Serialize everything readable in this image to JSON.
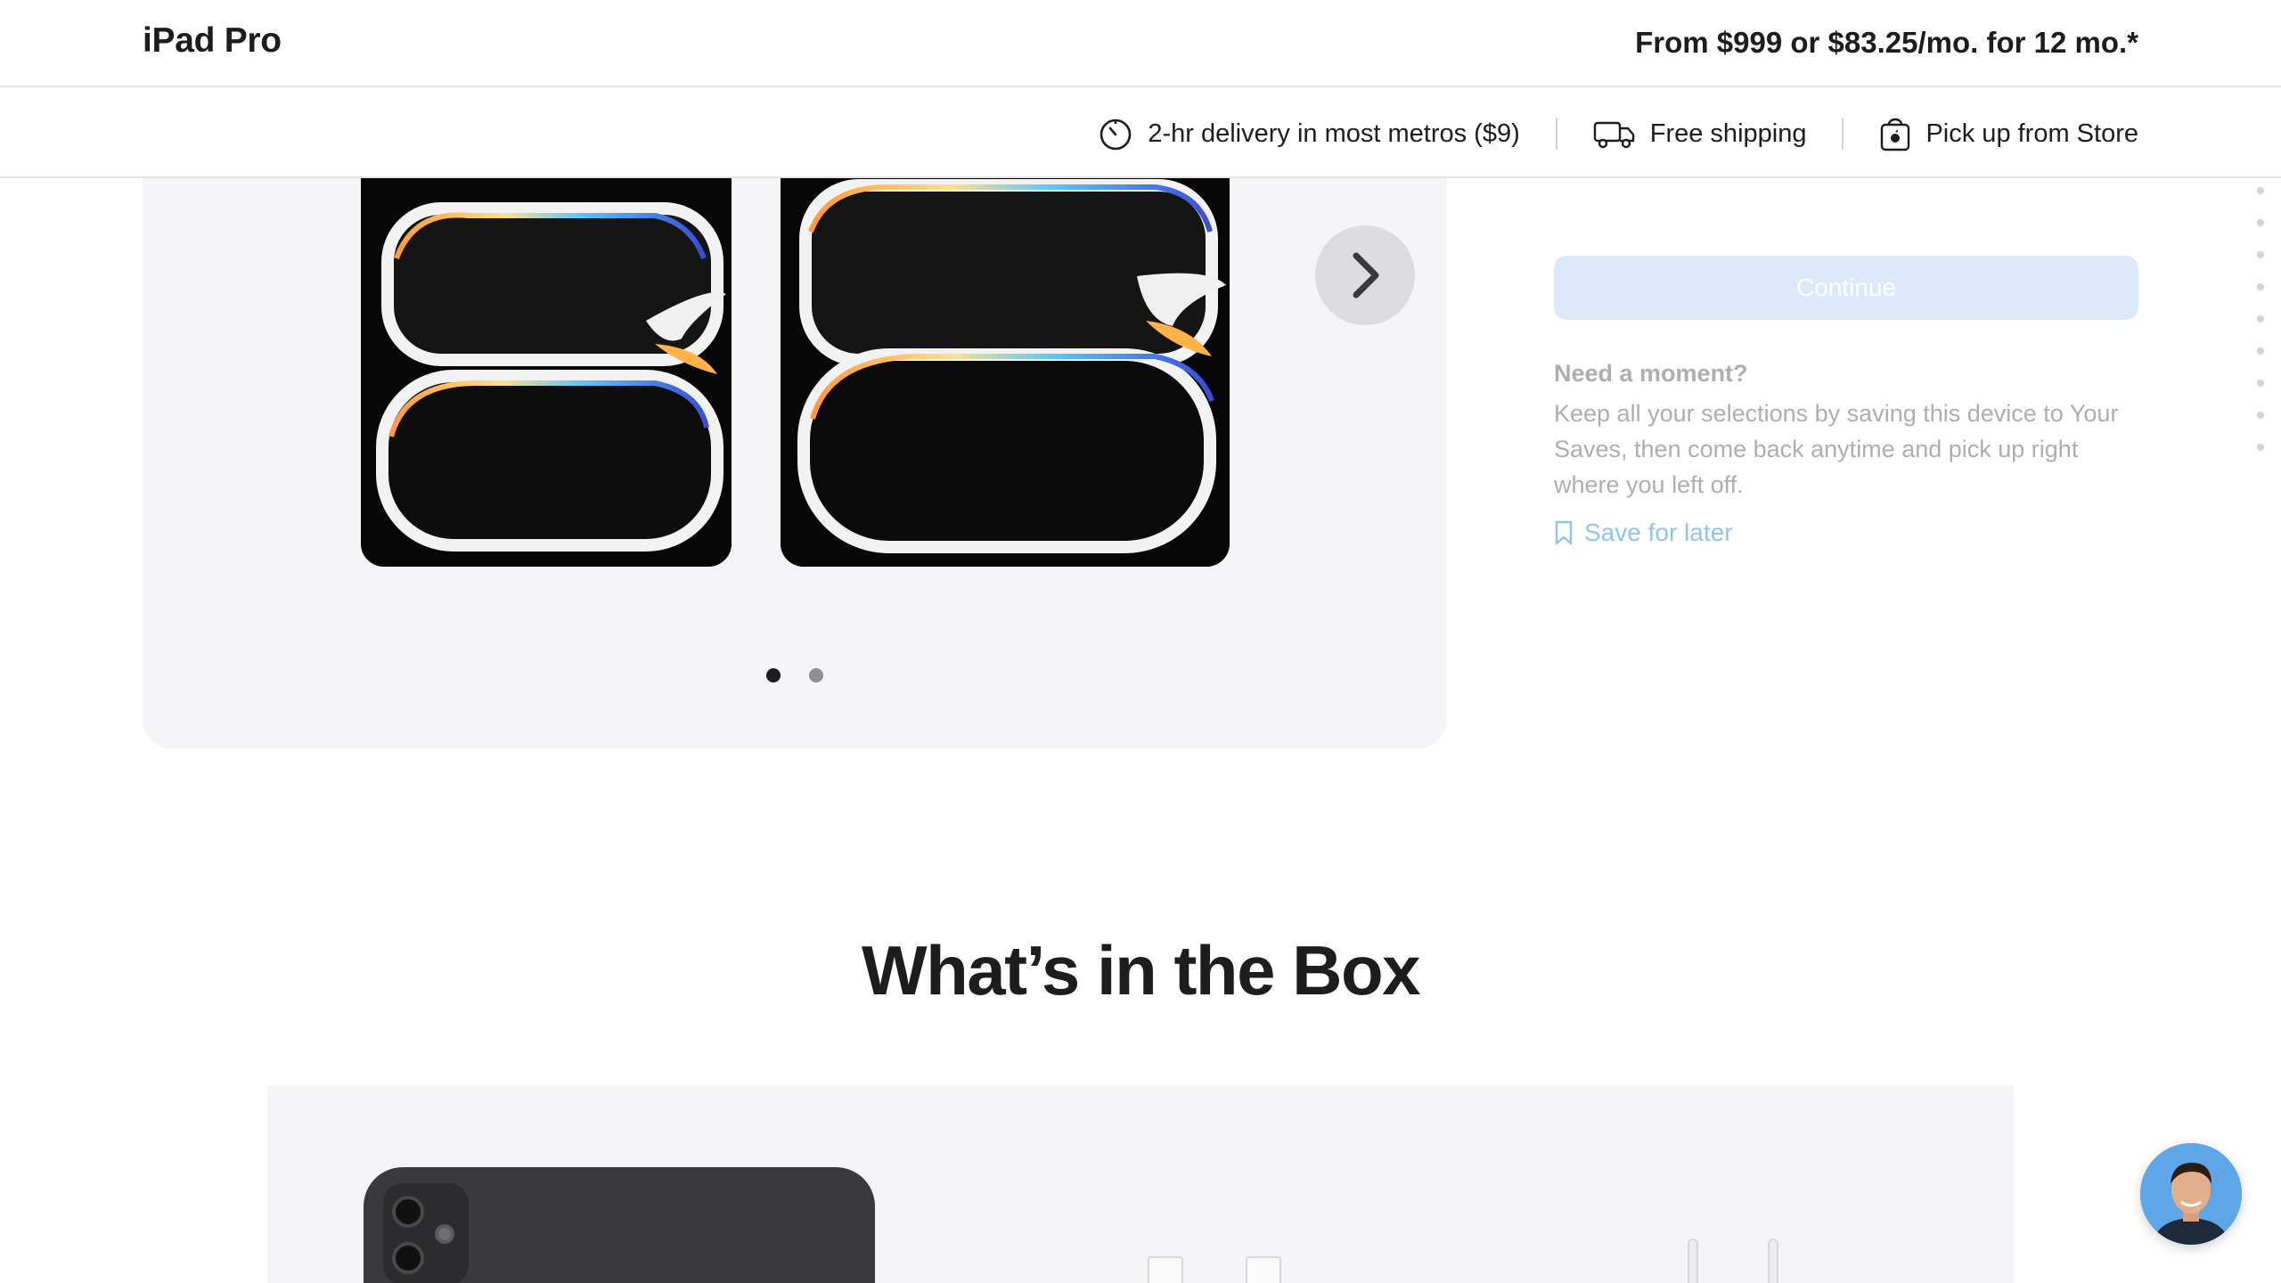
{
  "header": {
    "title": "iPad Pro",
    "price_summary": "From $999 or $83.25/mo. for 12 mo.*"
  },
  "delivery": {
    "items": [
      {
        "icon": "clock-icon",
        "label": "2-hr delivery in most metros ($9)"
      },
      {
        "icon": "truck-icon",
        "label": "Free shipping"
      },
      {
        "icon": "store-bag-icon",
        "label": "Pick up from Store"
      }
    ]
  },
  "gallery": {
    "slide_count": 2,
    "active_slide": 1,
    "next_icon": "chevron-right-icon"
  },
  "purchase": {
    "continue_label": "Continue",
    "need_moment_title": "Need a moment?",
    "need_moment_body": "Keep all your selections by saving this device to Your Saves, then come back anytime and pick up right where you left off.",
    "save_for_later_label": "Save for later",
    "save_icon": "bookmark-icon"
  },
  "box": {
    "heading": "What’s in the Box"
  },
  "colors": {
    "text": "#1d1d1f",
    "muted": "#aeaeb2",
    "accent_disabled": "#dbe9fb",
    "link_disabled": "#8fc2f6",
    "panel": "#f5f5f7"
  }
}
